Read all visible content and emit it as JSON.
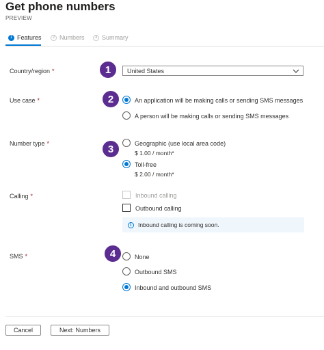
{
  "header": {
    "title": "Get phone numbers",
    "subtitle": "PREVIEW"
  },
  "tabs": [
    {
      "number": "1",
      "label": "Features"
    },
    {
      "number": "2",
      "label": "Numbers"
    },
    {
      "number": "3",
      "label": "Summary"
    }
  ],
  "form": {
    "country": {
      "label": "Country/region",
      "required": "*",
      "value": "United States"
    },
    "use_case": {
      "label": "Use case",
      "required": "*",
      "options": [
        {
          "label": "An application will be making calls or sending SMS messages",
          "checked": true
        },
        {
          "label": "A person will be making calls or sending SMS messages",
          "checked": false
        }
      ]
    },
    "number_type": {
      "label": "Number type",
      "required": "*",
      "options": [
        {
          "label": "Geographic (use local area code)",
          "price": "$ 1.00 / month*",
          "checked": false
        },
        {
          "label": "Toll-free",
          "price": "$ 2.00 / month*",
          "checked": true
        }
      ]
    },
    "calling": {
      "label": "Calling",
      "required": "*",
      "options": [
        {
          "label": "Inbound calling",
          "disabled": true
        },
        {
          "label": "Outbound calling",
          "disabled": false
        }
      ],
      "info": "Inbound calling is coming soon."
    },
    "sms": {
      "label": "SMS",
      "required": "*",
      "options": [
        {
          "label": "None",
          "checked": false
        },
        {
          "label": "Outbound SMS",
          "checked": false
        },
        {
          "label": "Inbound and outbound SMS",
          "checked": true
        }
      ]
    }
  },
  "callouts": [
    "1",
    "2",
    "3",
    "4"
  ],
  "footer": {
    "cancel_label": "Cancel",
    "next_label": "Next: Numbers"
  },
  "colors": {
    "accent": "#0078d4",
    "callout": "#5c2d91",
    "required": "#a4262c"
  }
}
